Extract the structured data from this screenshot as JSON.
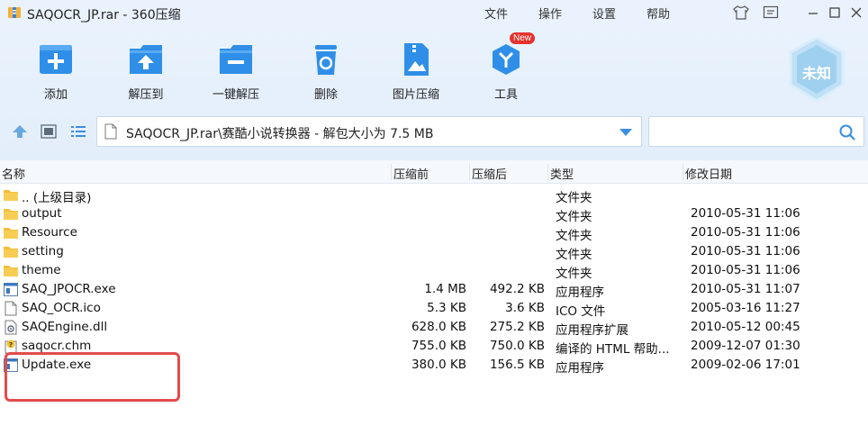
{
  "window": {
    "title": "SAQOCR_JP.rar - 360压缩",
    "menu": [
      "文件",
      "操作",
      "设置",
      "帮助"
    ]
  },
  "toolbar": {
    "buttons": [
      {
        "label": "添加",
        "icon": "add-icon"
      },
      {
        "label": "解压到",
        "icon": "extract-to-icon"
      },
      {
        "label": "一键解压",
        "icon": "one-click-extract-icon"
      },
      {
        "label": "删除",
        "icon": "delete-icon"
      },
      {
        "label": "图片压缩",
        "icon": "image-compress-icon"
      },
      {
        "label": "工具",
        "icon": "tools-icon"
      }
    ],
    "new_badge": "New",
    "rank_badge": "未知",
    "accent": "#2f8fe8"
  },
  "navbar": {
    "path": "SAQOCR_JP.rar\\赛酷小说转换器 - 解包大小为 7.5 MB",
    "search_placeholder": ""
  },
  "columns": [
    "名称",
    "压缩前",
    "压缩后",
    "类型",
    "修改日期"
  ],
  "files": [
    {
      "name": ".. (上级目录)",
      "size": "",
      "packed": "",
      "type": "文件夹",
      "date": "",
      "icon": "folder-icon"
    },
    {
      "name": "output",
      "size": "",
      "packed": "",
      "type": "文件夹",
      "date": "2010-05-31 11:06",
      "icon": "folder-icon"
    },
    {
      "name": "Resource",
      "size": "",
      "packed": "",
      "type": "文件夹",
      "date": "2010-05-31 11:06",
      "icon": "folder-icon"
    },
    {
      "name": "setting",
      "size": "",
      "packed": "",
      "type": "文件夹",
      "date": "2010-05-31 11:06",
      "icon": "folder-icon"
    },
    {
      "name": "theme",
      "size": "",
      "packed": "",
      "type": "文件夹",
      "date": "2010-05-31 11:06",
      "icon": "folder-icon"
    },
    {
      "name": "SAQ_JPOCR.exe",
      "size": "1.4 MB",
      "packed": "492.2 KB",
      "type": "应用程序",
      "date": "2010-05-31 11:07",
      "icon": "exe-icon"
    },
    {
      "name": "SAQ_OCR.ico",
      "size": "5.3 KB",
      "packed": "3.6 KB",
      "type": "ICO 文件",
      "date": "2005-03-16 11:27",
      "icon": "file-icon"
    },
    {
      "name": "SAQEngine.dll",
      "size": "628.0 KB",
      "packed": "275.2 KB",
      "type": "应用程序扩展",
      "date": "2010-05-12 00:45",
      "icon": "dll-icon"
    },
    {
      "name": "saqocr.chm",
      "size": "755.0 KB",
      "packed": "750.0 KB",
      "type": "编译的 HTML 帮助...",
      "date": "2009-12-07 01:30",
      "icon": "help-file-icon"
    },
    {
      "name": "Update.exe",
      "size": "380.0 KB",
      "packed": "156.5 KB",
      "type": "应用程序",
      "date": "2009-02-06 17:01",
      "icon": "exe-icon"
    }
  ]
}
